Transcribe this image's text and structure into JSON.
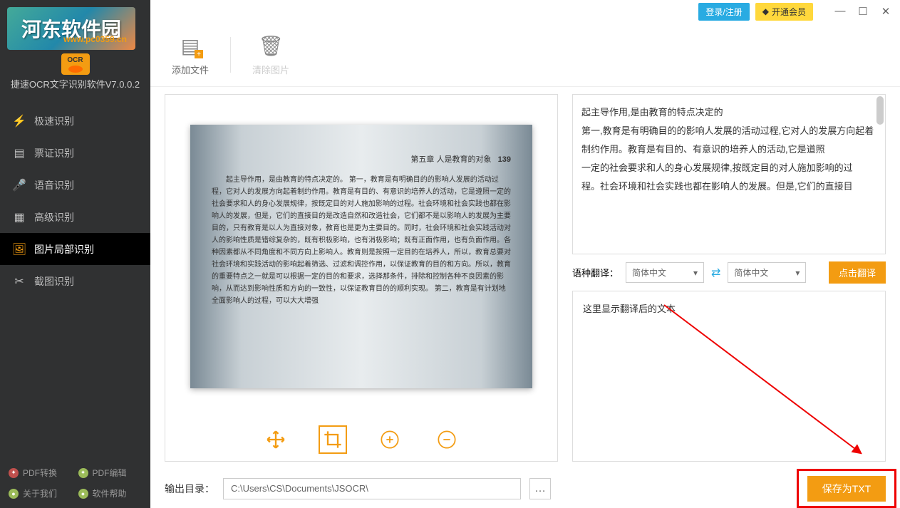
{
  "app": {
    "name": "河东软件园",
    "url": "www.pc0359.cn",
    "ocr": "OCR",
    "title": "捷速OCR文字识别软件V7.0.0.2"
  },
  "titlebar": {
    "login": "登录/注册",
    "vip": "开通会员"
  },
  "toolbar": {
    "add": "添加文件",
    "clear": "清除图片"
  },
  "nav": {
    "items": [
      {
        "label": "极速识别",
        "icon": "⚡"
      },
      {
        "label": "票证识别",
        "icon": "▤"
      },
      {
        "label": "语音识别",
        "icon": "🎤"
      },
      {
        "label": "高级识别",
        "icon": "▦"
      },
      {
        "label": "图片局部识别",
        "icon": "🖼"
      },
      {
        "label": "截图识别",
        "icon": "✂"
      }
    ]
  },
  "footer": {
    "pdfconv": "PDF转换",
    "pdfedit": "PDF编辑",
    "about": "关于我们",
    "help": "软件帮助"
  },
  "preview": {
    "chapter": "第五章  人是教育的对象",
    "page": "139",
    "body": "起主导作用，是由教育的特点决定的。\n第一，教育是有明确目的的影响人发展的活动过程，它对人的发展方向起着制约作用。教育是有目的、有意识的培养人的活动，它是遵照一定的社会要求和人的身心发展规律，按既定目的对人施加影响的过程。社会环境和社会实践也都在影响人的发展，但是，它们的直接目的是改造自然和改造社会，它们都不是以影响人的发展为主要目的，只有教育是以人为直接对象，教育也是更为主要目的。同时，社会环境和社会实践活动对人的影响性质是错综复杂的，既有积极影响，也有消极影响；既有正面作用，也有负面作用。各种因素都从不同角度和不同方向上影响人。教育则是按照一定目的在培养人，所以，教育总要对社会环境和实践活动的影响起着筛选、过滤和调控作用，以保证教育的目的和方向。所以，教育的重要特点之一就是可以根据一定的目的和要求，选择那条件，排除和控制各种不良因素的影响，从而达到影响性质和方向的一致性，以保证教育目的的顺利实现。\n第二，教育是有计划地全面影响人的过程，可以大大增强"
  },
  "ocr": {
    "l1": "起主导作用,是由教育的特点决定的",
    "l2": "第一,教育是有明确目的的影响人发展的活动过程,它对人的发展方向起着制约作用。教育是有目的、有意识的培养人的活动,它是道照",
    "l3": "一定的社会要求和人的身心发展规律,按既定目的对人施加影响的过",
    "l4": "程。社会环境和社会实践也都在影响人的发展。但是,它们的直接目"
  },
  "translate": {
    "label": "语种翻译：",
    "from": "简体中文",
    "to": "简体中文",
    "btn": "点击翻译",
    "placeholder": "这里显示翻译后的文本"
  },
  "output": {
    "label": "输出目录：",
    "path": "C:\\Users\\CS\\Documents\\JSOCR\\",
    "save": "保存为TXT"
  }
}
